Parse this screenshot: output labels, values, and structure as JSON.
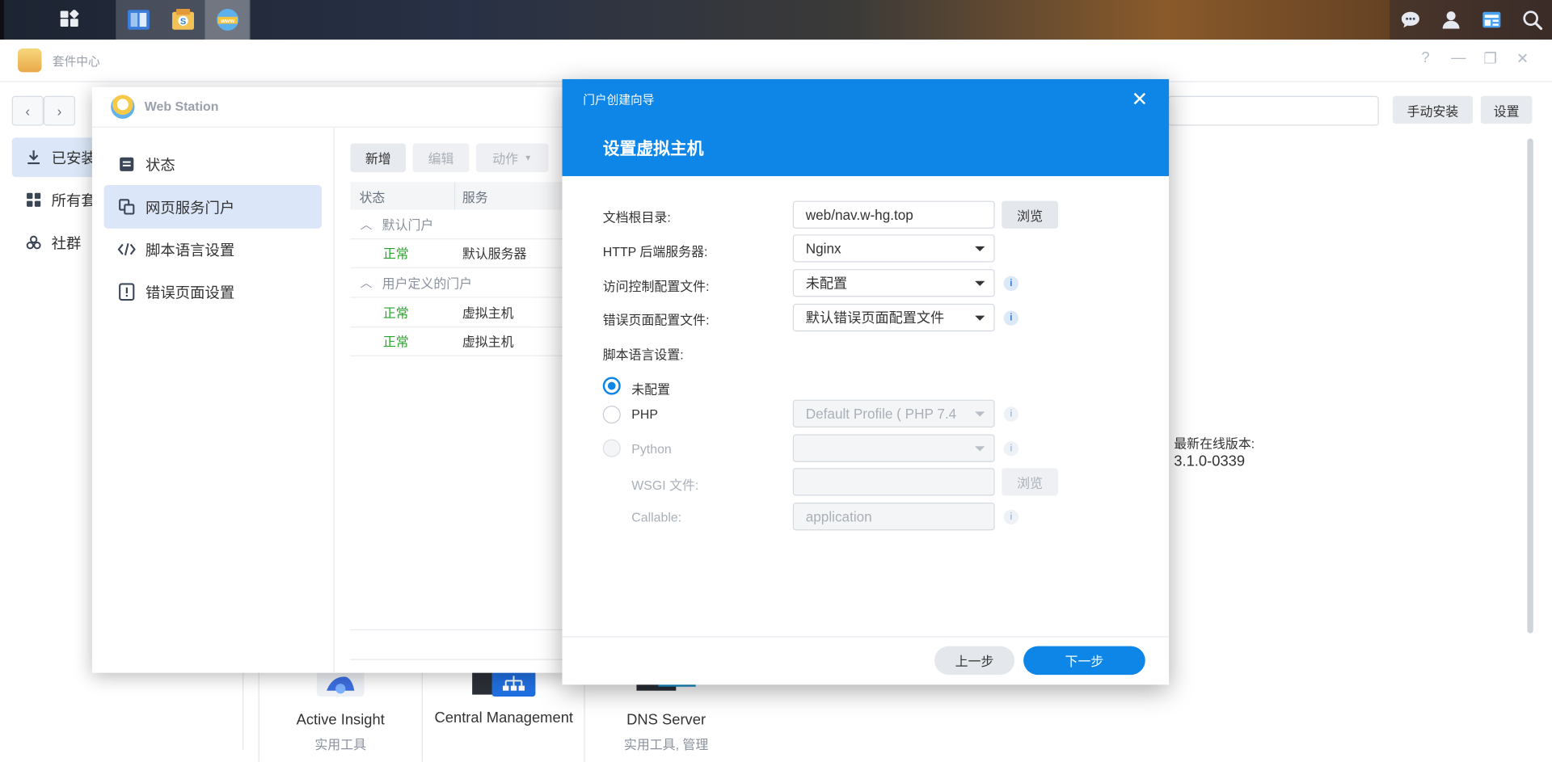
{
  "taskbar": {
    "apps": [
      "file-manager-icon",
      "package-center-icon",
      "web-station-icon"
    ],
    "right_icons": [
      "chat-icon",
      "user-icon",
      "widgets-icon",
      "search-icon"
    ]
  },
  "package_center": {
    "title": "套件中心",
    "manual_install": "手动安装",
    "settings": "设置",
    "sidebar": [
      {
        "label": "已安装",
        "icon": "download-icon"
      },
      {
        "label": "所有套",
        "icon": "grid-icon"
      },
      {
        "label": "社群",
        "icon": "community-icon"
      }
    ],
    "latest_label": "最新在线版本:",
    "latest_version": "3.1.0-0339",
    "packages": [
      {
        "name": "Active Insight",
        "category": "实用工具"
      },
      {
        "name": "Central Management",
        "category": ""
      },
      {
        "name": "DNS Server",
        "category": "实用工具, 管理"
      }
    ]
  },
  "web_station": {
    "title": "Web Station",
    "menu": [
      {
        "label": "状态",
        "icon": "status-icon"
      },
      {
        "label": "网页服务门户",
        "icon": "portal-icon"
      },
      {
        "label": "脚本语言设置",
        "icon": "code-icon"
      },
      {
        "label": "错误页面设置",
        "icon": "error-page-icon"
      }
    ],
    "toolbar": {
      "add": "新增",
      "edit": "编辑",
      "action": "动作"
    },
    "columns": {
      "status": "状态",
      "service": "服务"
    },
    "groups": [
      {
        "name": "默认门户",
        "rows": [
          {
            "status": "正常",
            "service": "默认服务器"
          }
        ]
      },
      {
        "name": "用户定义的门户",
        "rows": [
          {
            "status": "正常",
            "service": "虚拟主机"
          },
          {
            "status": "正常",
            "service": "虚拟主机"
          }
        ]
      }
    ]
  },
  "dialog": {
    "wizard_title": "门户创建向导",
    "step_title": "设置虚拟主机",
    "doc_root_label": "文档根目录:",
    "doc_root_value": "web/nav.w-hg.top",
    "browse": "浏览",
    "http_backend_label": "HTTP 后端服务器:",
    "http_backend_value": "Nginx",
    "access_control_label": "访问控制配置文件:",
    "access_control_value": "未配置",
    "error_page_label": "错误页面配置文件:",
    "error_page_value": "默认错误页面配置文件",
    "script_label": "脚本语言设置:",
    "radio_none": "未配置",
    "radio_php": "PHP",
    "php_profile": "Default Profile ( PHP 7.4",
    "radio_python": "Python",
    "wsgi_label": "WSGI 文件:",
    "wsgi_browse": "浏览",
    "callable_label": "Callable:",
    "callable_placeholder": "application",
    "prev": "上一步",
    "next": "下一步"
  }
}
